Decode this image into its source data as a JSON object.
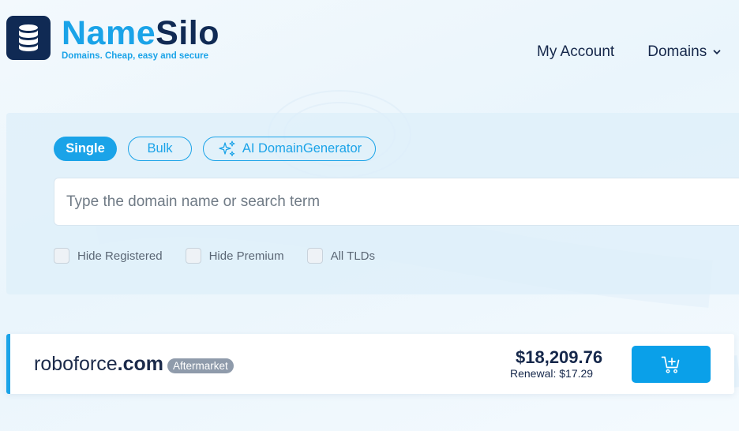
{
  "brand": {
    "name_part1": "Name",
    "name_part2": "Silo",
    "tagline": "Domains. Cheap, easy and secure",
    "logo_icon": "database-icon"
  },
  "nav": {
    "items": [
      {
        "label": "My Account"
      },
      {
        "label": "Domains",
        "icon": "chevron-down-icon"
      }
    ]
  },
  "search": {
    "tabs": [
      {
        "label": "Single",
        "active": true
      },
      {
        "label": "Bulk",
        "active": false
      },
      {
        "label": "AI DomainGenerator",
        "active": false,
        "icon": "sparkles-icon"
      }
    ],
    "placeholder": "Type the domain name or search term",
    "value": "",
    "filters": [
      {
        "label": "Hide Registered",
        "checked": false
      },
      {
        "label": "Hide Premium",
        "checked": false
      },
      {
        "label": "All TLDs",
        "checked": false
      }
    ]
  },
  "results": [
    {
      "sld": "roboforce",
      "tld": ".com",
      "badge": "Aftermarket",
      "price": "$18,209.76",
      "renewal": "Renewal: $17.29",
      "action_icon": "add-to-cart-icon"
    }
  ],
  "colors": {
    "accent": "#1aa3e8",
    "brand_dark": "#102a54",
    "badge": "#8f9bab"
  }
}
